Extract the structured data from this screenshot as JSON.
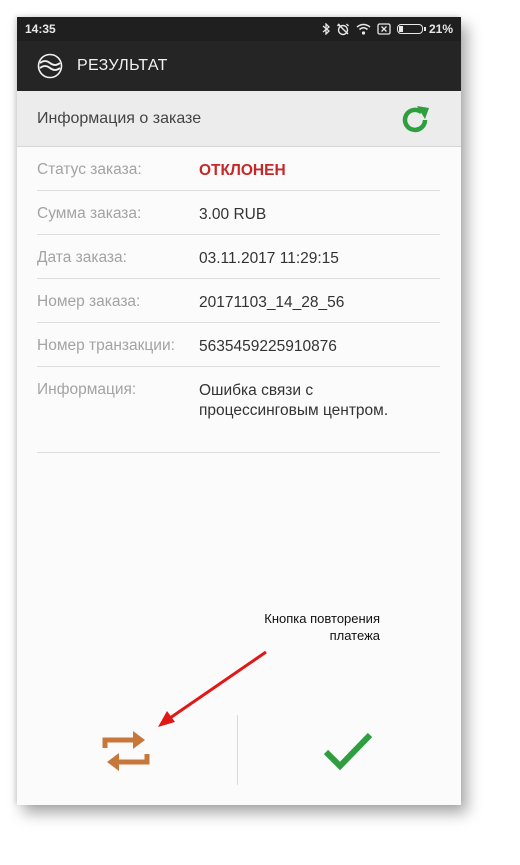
{
  "status_bar": {
    "time": "14:35",
    "battery_percent": "21%",
    "battery_level": 0.21,
    "icons": [
      "bluetooth-icon",
      "alarm-off-icon",
      "wifi-icon",
      "sim-off-icon",
      "battery-icon"
    ]
  },
  "toolbar": {
    "title": "РЕЗУЛЬТАТ",
    "logo_icon": "waves-logo-icon"
  },
  "header": {
    "title": "Информация о заказе",
    "refresh_icon": "refresh-icon",
    "accent": "#2e9e3e"
  },
  "order_info": {
    "rows": [
      {
        "label": "Статус заказа:",
        "value": "ОТКЛОНЕН"
      },
      {
        "label": "Сумма заказа:",
        "value": "3.00 RUB"
      },
      {
        "label": "Дата заказа:",
        "value": "03.11.2017 11:29:15"
      },
      {
        "label": "Номер заказа:",
        "value": "20171103_14_28_56"
      },
      {
        "label": "Номер транзакции:",
        "value": "5635459225910876"
      },
      {
        "label": "Информация:",
        "value_lines": [
          "Ошибка связи с",
          "процессинговым центром."
        ]
      }
    ],
    "status_color": "#c62828"
  },
  "annotation": {
    "lines": [
      "Кнопка повторения",
      "платежа"
    ],
    "arrow_color": "#e01818"
  },
  "bottom_bar": {
    "repeat_icon": "repeat-icon",
    "repeat_color": "#c8773a",
    "confirm_icon": "checkmark-icon",
    "confirm_color": "#2e9e3e"
  }
}
